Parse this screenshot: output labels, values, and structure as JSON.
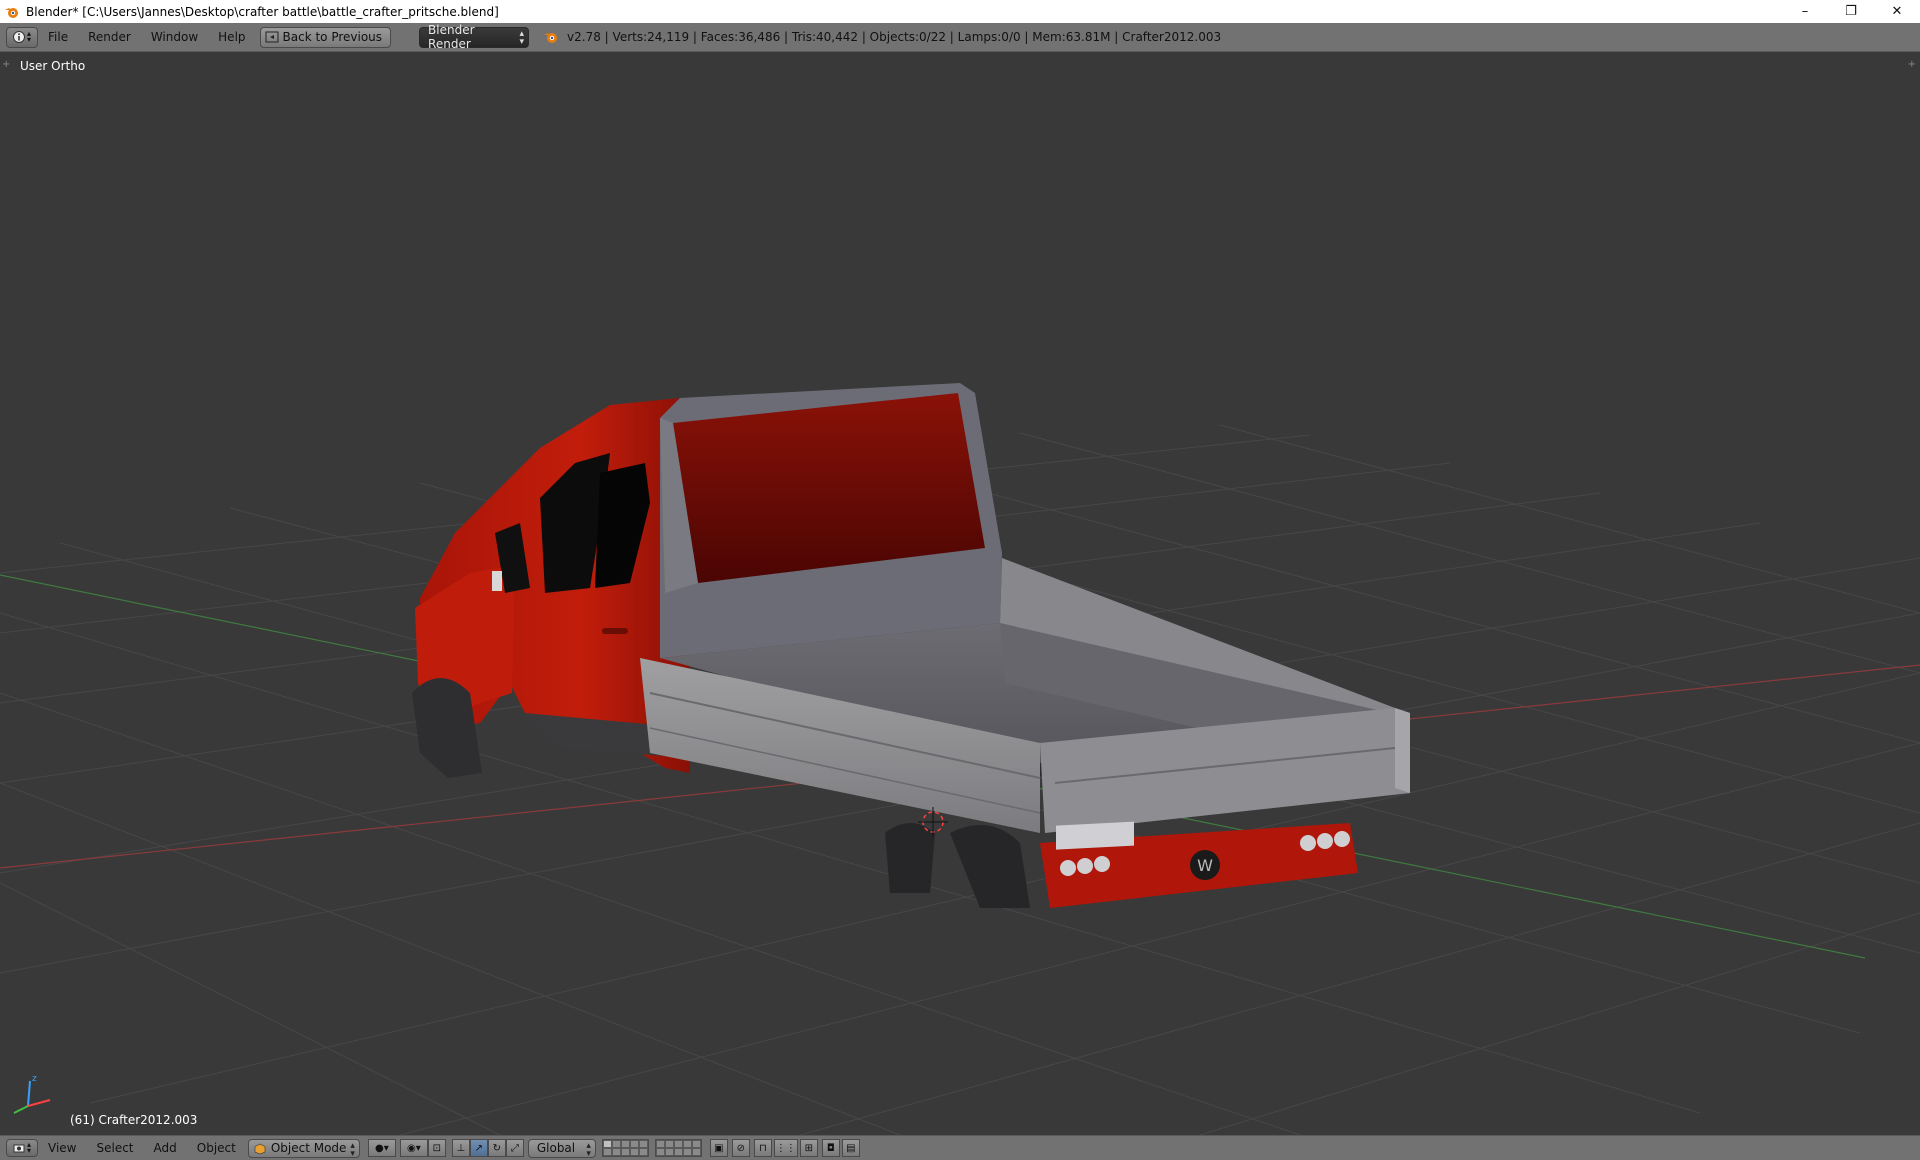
{
  "window": {
    "title": "Blender* [C:\\Users\\Jannes\\Desktop\\crafter battle\\battle_crafter_pritsche.blend]",
    "controls": [
      "–",
      "❐",
      "✕"
    ]
  },
  "topbar": {
    "menus": [
      "File",
      "Render",
      "Window",
      "Help"
    ],
    "back_button": "Back to Previous",
    "render_engine": "Blender Render",
    "stats": "v2.78 | Verts:24,119 | Faces:36,486 | Tris:40,442 | Objects:0/22 | Lamps:0/0 | Mem:63.81M | Crafter2012.003"
  },
  "viewport": {
    "view_name": "User Ortho",
    "object_info": "(61) Crafter2012.003",
    "colors": {
      "background": "#393939",
      "grid": "#4a4a4a",
      "x_axis": "#8a3a3a",
      "y_axis": "#3f7a3f",
      "body_red": "#b01a0a",
      "bed_gray": "#8a8a8c"
    }
  },
  "bottombar": {
    "menus": [
      "View",
      "Select",
      "Add",
      "Object"
    ],
    "mode": "Object Mode",
    "orientation": "Global"
  }
}
